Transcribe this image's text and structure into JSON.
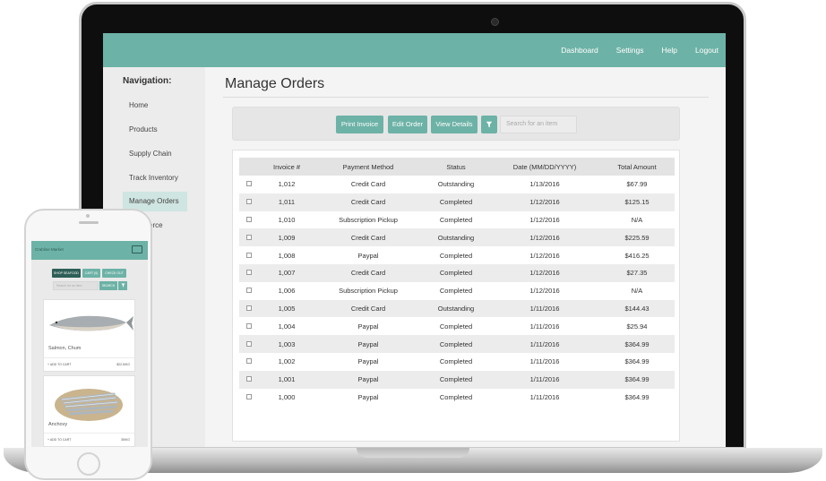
{
  "topnav": [
    "Dashboard",
    "Settings",
    "Help",
    "Logout"
  ],
  "sidebar": {
    "title": "Navigation:",
    "items": [
      "Home",
      "Products",
      "Supply Chain",
      "Track Inventory",
      "Manage Orders",
      "erce"
    ]
  },
  "main": {
    "title": "Manage Orders",
    "toolbar": {
      "print": "Print Invoice",
      "edit": "Edit Order",
      "view": "View Details",
      "filter_icon": "filter-icon",
      "search_placeholder": "Search for an item"
    },
    "table": {
      "headers": [
        "Invoice #",
        "Payment Method",
        "Status",
        "Date (MM/DD/YYYY)",
        "Total Amount"
      ],
      "rows": [
        [
          "1,012",
          "Credit Card",
          "Outstanding",
          "1/13/2016",
          "$67.99"
        ],
        [
          "1,011",
          "Credit Card",
          "Completed",
          "1/12/2016",
          "$125.15"
        ],
        [
          "1,010",
          "Subscription Pickup",
          "Completed",
          "1/12/2016",
          "N/A"
        ],
        [
          "1,009",
          "Credit Card",
          "Outstanding",
          "1/12/2016",
          "$225.59"
        ],
        [
          "1,008",
          "Paypal",
          "Completed",
          "1/12/2016",
          "$416.25"
        ],
        [
          "1,007",
          "Credit Card",
          "Completed",
          "1/12/2016",
          "$27.35"
        ],
        [
          "1,006",
          "Subscription Pickup",
          "Completed",
          "1/12/2016",
          "N/A"
        ],
        [
          "1,005",
          "Credit Card",
          "Outstanding",
          "1/11/2016",
          "$144.43"
        ],
        [
          "1,004",
          "Paypal",
          "Completed",
          "1/11/2016",
          "$25.94"
        ],
        [
          "1,003",
          "Paypal",
          "Completed",
          "1/11/2016",
          "$364.99"
        ],
        [
          "1,002",
          "Paypal",
          "Completed",
          "1/11/2016",
          "$364.99"
        ],
        [
          "1,001",
          "Paypal",
          "Completed",
          "1/11/2016",
          "$364.99"
        ],
        [
          "1,000",
          "Paypal",
          "Completed",
          "1/11/2016",
          "$364.99"
        ]
      ]
    }
  },
  "phone": {
    "title": "Crabline Market",
    "buttons": [
      "SHOP SEAFOOD",
      "CART (0)",
      "CHECK OUT"
    ],
    "search_placeholder": "Search for an item",
    "search_button": "SEARCH",
    "products": [
      {
        "name": "Salmon, Chum",
        "add": "+ ADD TO CART",
        "price": "$22.5/KG"
      },
      {
        "name": "Anchovy",
        "add": "+ ADD TO CART",
        "price": "35/KG"
      }
    ]
  },
  "colors": {
    "accent": "#6db2a6",
    "accent_dark": "#2e5f57",
    "active_nav": "#cfe5e1"
  }
}
